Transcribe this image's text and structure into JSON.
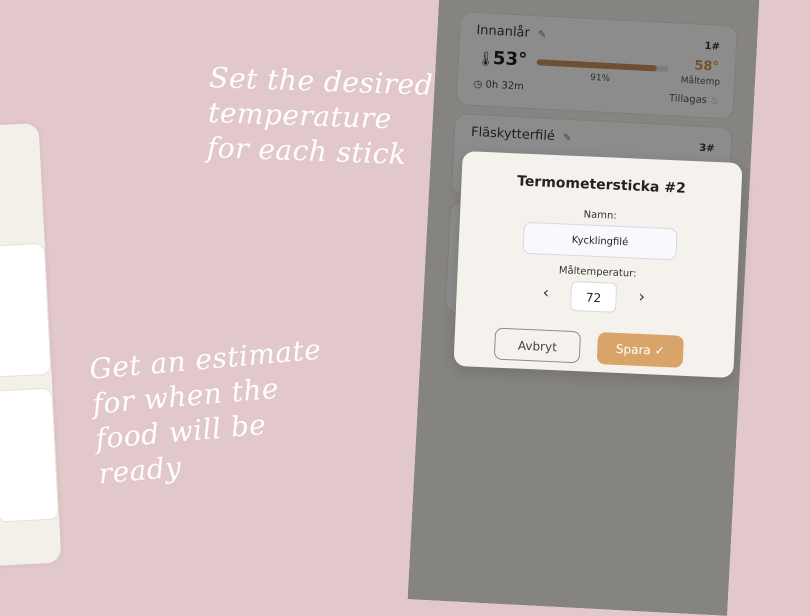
{
  "captions": {
    "top": [
      "Set the desired",
      "temperature",
      "for each stick"
    ],
    "bottom": [
      "Get an estimate",
      "for when the",
      "food will be",
      "ready"
    ]
  },
  "cards": [
    {
      "name": "Innanlår",
      "number": "1#",
      "current_temp": "53°",
      "progress_percent": 91,
      "progress_label": "91%",
      "target_temp": "58°",
      "target_label": "Måltemp",
      "elapsed": "0h 32m",
      "status": "Tillagas"
    },
    {
      "name": "Fläskytterfilé",
      "number": "3#"
    }
  ],
  "modal": {
    "title": "Termometersticka #2",
    "name_label": "Namn:",
    "name_value": "Kycklingfilé",
    "temp_label": "Måltemperatur:",
    "temp_value": "72",
    "cancel_label": "Avbryt",
    "save_label": "Spara",
    "save_icon": "✓",
    "prev_icon": "‹",
    "next_icon": "›"
  },
  "colors": {
    "background": "#e2c8cb",
    "accent": "#d9a46a",
    "target_temp": "#d9964a"
  }
}
